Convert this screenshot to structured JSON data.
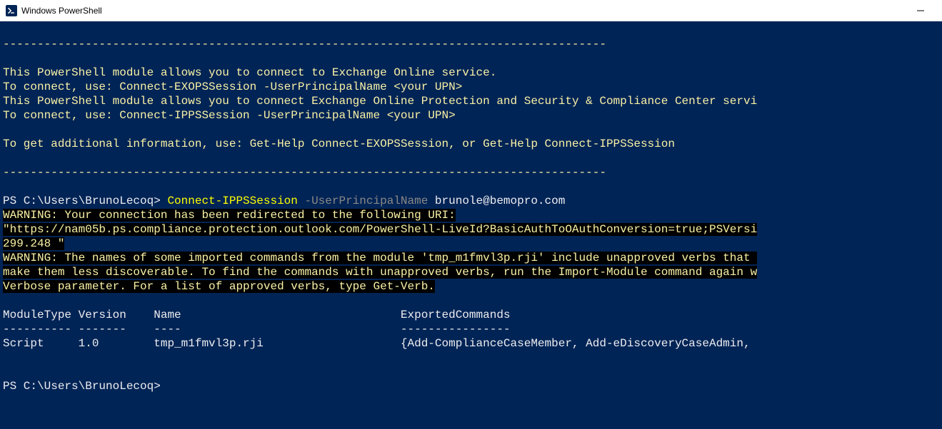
{
  "window": {
    "title": "Windows PowerShell"
  },
  "banner": {
    "hr": "----------------------------------------------------------------------------------------",
    "line1": "This PowerShell module allows you to connect to Exchange Online service.",
    "line2": "To connect, use: Connect-EXOPSSession -UserPrincipalName <your UPN>",
    "line3": "This PowerShell module allows you to connect Exchange Online Protection and Security & Compliance Center servi",
    "line4": "To connect, use: Connect-IPPSSession -UserPrincipalName <your UPN>",
    "line5": "To get additional information, use: Get-Help Connect-EXOPSSession, or Get-Help Connect-IPPSSession"
  },
  "prompt1": {
    "ps": "PS C:\\Users\\BrunoLecoq> ",
    "cmd": "Connect-IPPSSession ",
    "param": "-UserPrincipalName ",
    "arg": "brunole@bemopro.com"
  },
  "warn": {
    "l1": "WARNING: Your connection has been redirected to the following URI:",
    "l2": "\"https://nam05b.ps.compliance.protection.outlook.com/PowerShell-LiveId?BasicAuthToOAuthConversion=true;PSVersi",
    "l3": "299.248 \"",
    "l4": "WARNING: The names of some imported commands from the module 'tmp_m1fmvl3p.rji' include unapproved verbs that ",
    "l5": "make them less discoverable. To find the commands with unapproved verbs, run the Import-Module command again w",
    "l6": "Verbose parameter. For a list of approved verbs, type Get-Verb."
  },
  "table": {
    "header": "ModuleType Version    Name                                ExportedCommands",
    "sep": "---------- -------    ----                                ----------------",
    "row": "Script     1.0        tmp_m1fmvl3p.rji                    {Add-ComplianceCaseMember, Add-eDiscoveryCaseAdmin, "
  },
  "prompt2": {
    "ps": "PS C:\\Users\\BrunoLecoq>"
  }
}
